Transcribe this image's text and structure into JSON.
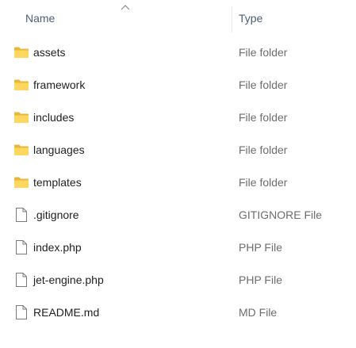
{
  "columns": {
    "name_label": "Name",
    "type_label": "Type",
    "sort": "ascending"
  },
  "colors": {
    "folder_back": "#e8b73a",
    "folder_front": "#ffd75e",
    "file_outline": "#7a7a7a",
    "header_text": "#4c607a",
    "type_text": "#6d6d6d"
  },
  "items": [
    {
      "name": "assets",
      "type": "File folder",
      "icon": "folder-icon"
    },
    {
      "name": "framework",
      "type": "File folder",
      "icon": "folder-icon"
    },
    {
      "name": "includes",
      "type": "File folder",
      "icon": "folder-icon"
    },
    {
      "name": "languages",
      "type": "File folder",
      "icon": "folder-icon"
    },
    {
      "name": "templates",
      "type": "File folder",
      "icon": "folder-icon"
    },
    {
      "name": ".gitignore",
      "type": "GITIGNORE File",
      "icon": "file-icon"
    },
    {
      "name": "index.php",
      "type": "PHP File",
      "icon": "file-icon"
    },
    {
      "name": "jet-engine.php",
      "type": "PHP File",
      "icon": "file-icon"
    },
    {
      "name": "README.md",
      "type": "MD File",
      "icon": "file-icon"
    }
  ]
}
